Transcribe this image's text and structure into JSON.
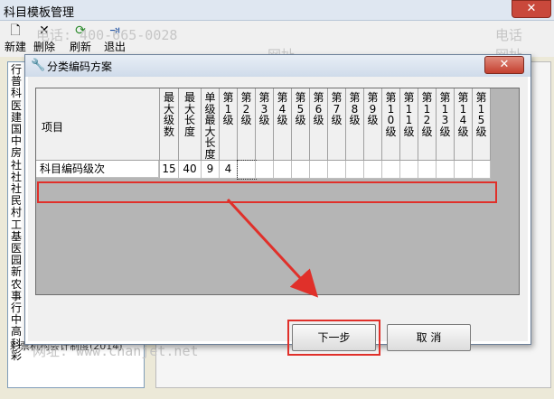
{
  "window": {
    "title": "科目模板管理",
    "close_label": "✕"
  },
  "toolbar": {
    "items": [
      {
        "label": "新建",
        "icon": "new-icon"
      },
      {
        "label": "删除",
        "icon": "delete-icon"
      },
      {
        "label": "刷新",
        "icon": "refresh-icon"
      },
      {
        "label": "退出",
        "icon": "exit-icon"
      }
    ]
  },
  "left_panel": {
    "vertical_text": "行普科医建国中房社社社民村工基医园新农事行中高科彩",
    "bottom_text": "彩票机构会计制度(2014)"
  },
  "dialog": {
    "title": "分类编码方案",
    "close_label": "✕",
    "columns": {
      "item": "项目",
      "max_levels": "最大级数",
      "max_length": "最大长度",
      "single_max": "单级最大长度",
      "levels": [
        "第1级",
        "第2级",
        "第3级",
        "第4级",
        "第5级",
        "第6级",
        "第7级",
        "第8级",
        "第9级",
        "第10级",
        "第11级",
        "第12级",
        "第13级",
        "第14级",
        "第15级"
      ]
    },
    "row": {
      "item": "科目编码级次",
      "max_levels": "15",
      "max_length": "40",
      "single_max": "9",
      "level_values": [
        "4",
        "",
        "",
        "",
        "",
        "",
        "",
        "",
        "",
        "",
        "",
        "",
        "",
        "",
        ""
      ]
    },
    "buttons": {
      "next": "下一步",
      "cancel": "取 消"
    }
  },
  "watermark": {
    "phone": "电话: 400-665-0028",
    "site": "网址: www.chanjet.net",
    "short": "电话",
    "short2": "网址"
  },
  "colors": {
    "highlight": "#e0302a",
    "titlebar": "#dfe7f1",
    "close": "#c9483b"
  }
}
